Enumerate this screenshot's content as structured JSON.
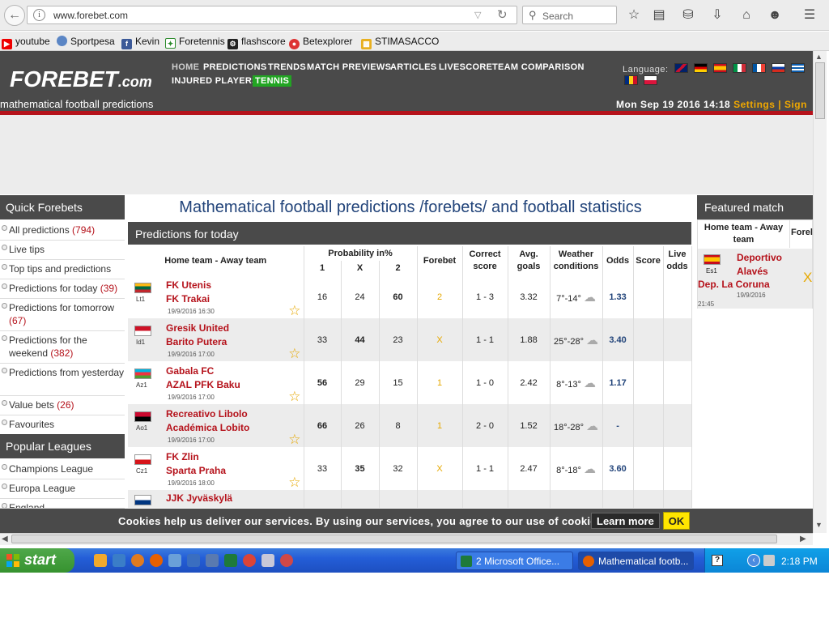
{
  "browser": {
    "url": "www.forebet.com",
    "search_placeholder": "Search",
    "bookmarks": [
      "youtube",
      "Sportpesa",
      "Kevin",
      "Foretennis",
      "flashscore",
      "Betexplorer",
      "STIMASACCO"
    ]
  },
  "site": {
    "logo": "FOREBET",
    "logo_suffix": ".com",
    "slogan": "mathematical football predictions",
    "nav": [
      "HOME",
      "PREDICTIONS",
      "TRENDS",
      "MATCH PREVIEWS",
      "ARTICLES",
      "LIVESCORE",
      "TEAM COMPARISON",
      "INJURED PLAYERS",
      "TENNIS"
    ],
    "language_label": "Language:",
    "datetime": "Mon Sep 19 2016 14:18",
    "settings": "Settings",
    "signin": "| Sign"
  },
  "quick_forebets": {
    "title": "Quick Forebets",
    "items": [
      {
        "label": "All predictions",
        "count": "(794)"
      },
      {
        "label": "Live tips",
        "count": ""
      },
      {
        "label": "Top tips and predictions",
        "count": ""
      },
      {
        "label": "Predictions for today",
        "count": "(39)"
      },
      {
        "label": "Predictions for tomorrow",
        "count": "(67)"
      },
      {
        "label": "Predictions for the weekend",
        "count": "(382)"
      },
      {
        "label": "Predictions from yesterday",
        "count": ""
      },
      {
        "label": "Value bets",
        "count": "(26)"
      },
      {
        "label": "Favourites",
        "count": ""
      }
    ]
  },
  "popular_leagues": {
    "title": "Popular Leagues",
    "items": [
      "Champions League",
      "Europa League",
      "England"
    ]
  },
  "main": {
    "title": "Mathematical football predictions /forebets/ and football statistics",
    "section": "Predictions for today",
    "columns": {
      "teams": "Home team - Away team",
      "probability": "Probability in%",
      "p1": "1",
      "px": "X",
      "p2": "2",
      "forebet": "Forebet",
      "correct_score": "Correct score",
      "avg_goals": "Avg. goals",
      "weather": "Weather conditions",
      "odds": "Odds",
      "score": "Score",
      "live_odds": "Live odds"
    },
    "rows": [
      {
        "code": "Lt1",
        "flag": [
          "#fdb913",
          "#006a44",
          "#c1272d"
        ],
        "home": "FK Utenis",
        "away": "FK Trakai",
        "date": "19/9/2016 16:30",
        "p1": "16",
        "px": "24",
        "p2": "60",
        "bold": "p2",
        "forebet": "2",
        "score": "1 - 3",
        "goals": "3.32",
        "weather": "7°-14°",
        "odds": "1.33"
      },
      {
        "code": "Id1",
        "flag": [
          "#ce1126",
          "#ffffff"
        ],
        "home": "Gresik United",
        "away": "Barito Putera",
        "date": "19/9/2016 17:00",
        "p1": "33",
        "px": "44",
        "p2": "23",
        "bold": "px",
        "forebet": "X",
        "score": "1 - 1",
        "goals": "1.88",
        "weather": "25°-28°",
        "odds": "3.40"
      },
      {
        "code": "Az1",
        "flag": [
          "#00b5e2",
          "#ef3340",
          "#509e2f"
        ],
        "home": "Gabala FC",
        "away": "AZAL PFK Baku",
        "date": "19/9/2016 17:00",
        "p1": "56",
        "px": "29",
        "p2": "15",
        "bold": "p1",
        "forebet": "1",
        "score": "1 - 0",
        "goals": "2.42",
        "weather": "8°-13°",
        "odds": "1.17"
      },
      {
        "code": "Ao1",
        "flag": [
          "#cc092f",
          "#000000"
        ],
        "home": "Recreativo Libolo",
        "away": "Académica Lobito",
        "date": "19/9/2016 17:00",
        "p1": "66",
        "px": "26",
        "p2": "8",
        "bold": "p1",
        "forebet": "1",
        "score": "2 - 0",
        "goals": "1.52",
        "weather": "18°-28°",
        "odds": "-"
      },
      {
        "code": "Cz1",
        "flag": [
          "#ffffff",
          "#d7141a"
        ],
        "home": "FK Zlin",
        "away": "Sparta Praha",
        "date": "19/9/2016 18:00",
        "p1": "33",
        "px": "35",
        "p2": "32",
        "bold": "px",
        "forebet": "X",
        "score": "1 - 1",
        "goals": "2.47",
        "weather": "8°-18°",
        "odds": "3.60"
      },
      {
        "code": "",
        "flag": [
          "#ffffff",
          "#003580"
        ],
        "home": "JJK Jyväskylä",
        "away": "",
        "date": "",
        "p1": "",
        "px": "",
        "p2": "",
        "bold": "",
        "forebet": "",
        "score": "",
        "goals": "",
        "weather": "",
        "odds": ""
      }
    ]
  },
  "featured": {
    "title": "Featured match",
    "col_teams": "Home team - Away team",
    "col_forebet": "Forel",
    "code": "Es1",
    "home": "Deportivo Alavés",
    "away": "Dep. La Coruna",
    "date": "19/9/2016",
    "time": "21:45",
    "forebet": "X"
  },
  "cookie": {
    "text": "Cookies help us deliver our services. By using our services, you agree to our use of cookies.",
    "learn_more": "Learn more",
    "ok": "OK"
  },
  "taskbar": {
    "start": "start",
    "tasks": [
      "2 Microsoft Office...",
      "Mathematical footb..."
    ],
    "clock": "2:18 PM"
  }
}
